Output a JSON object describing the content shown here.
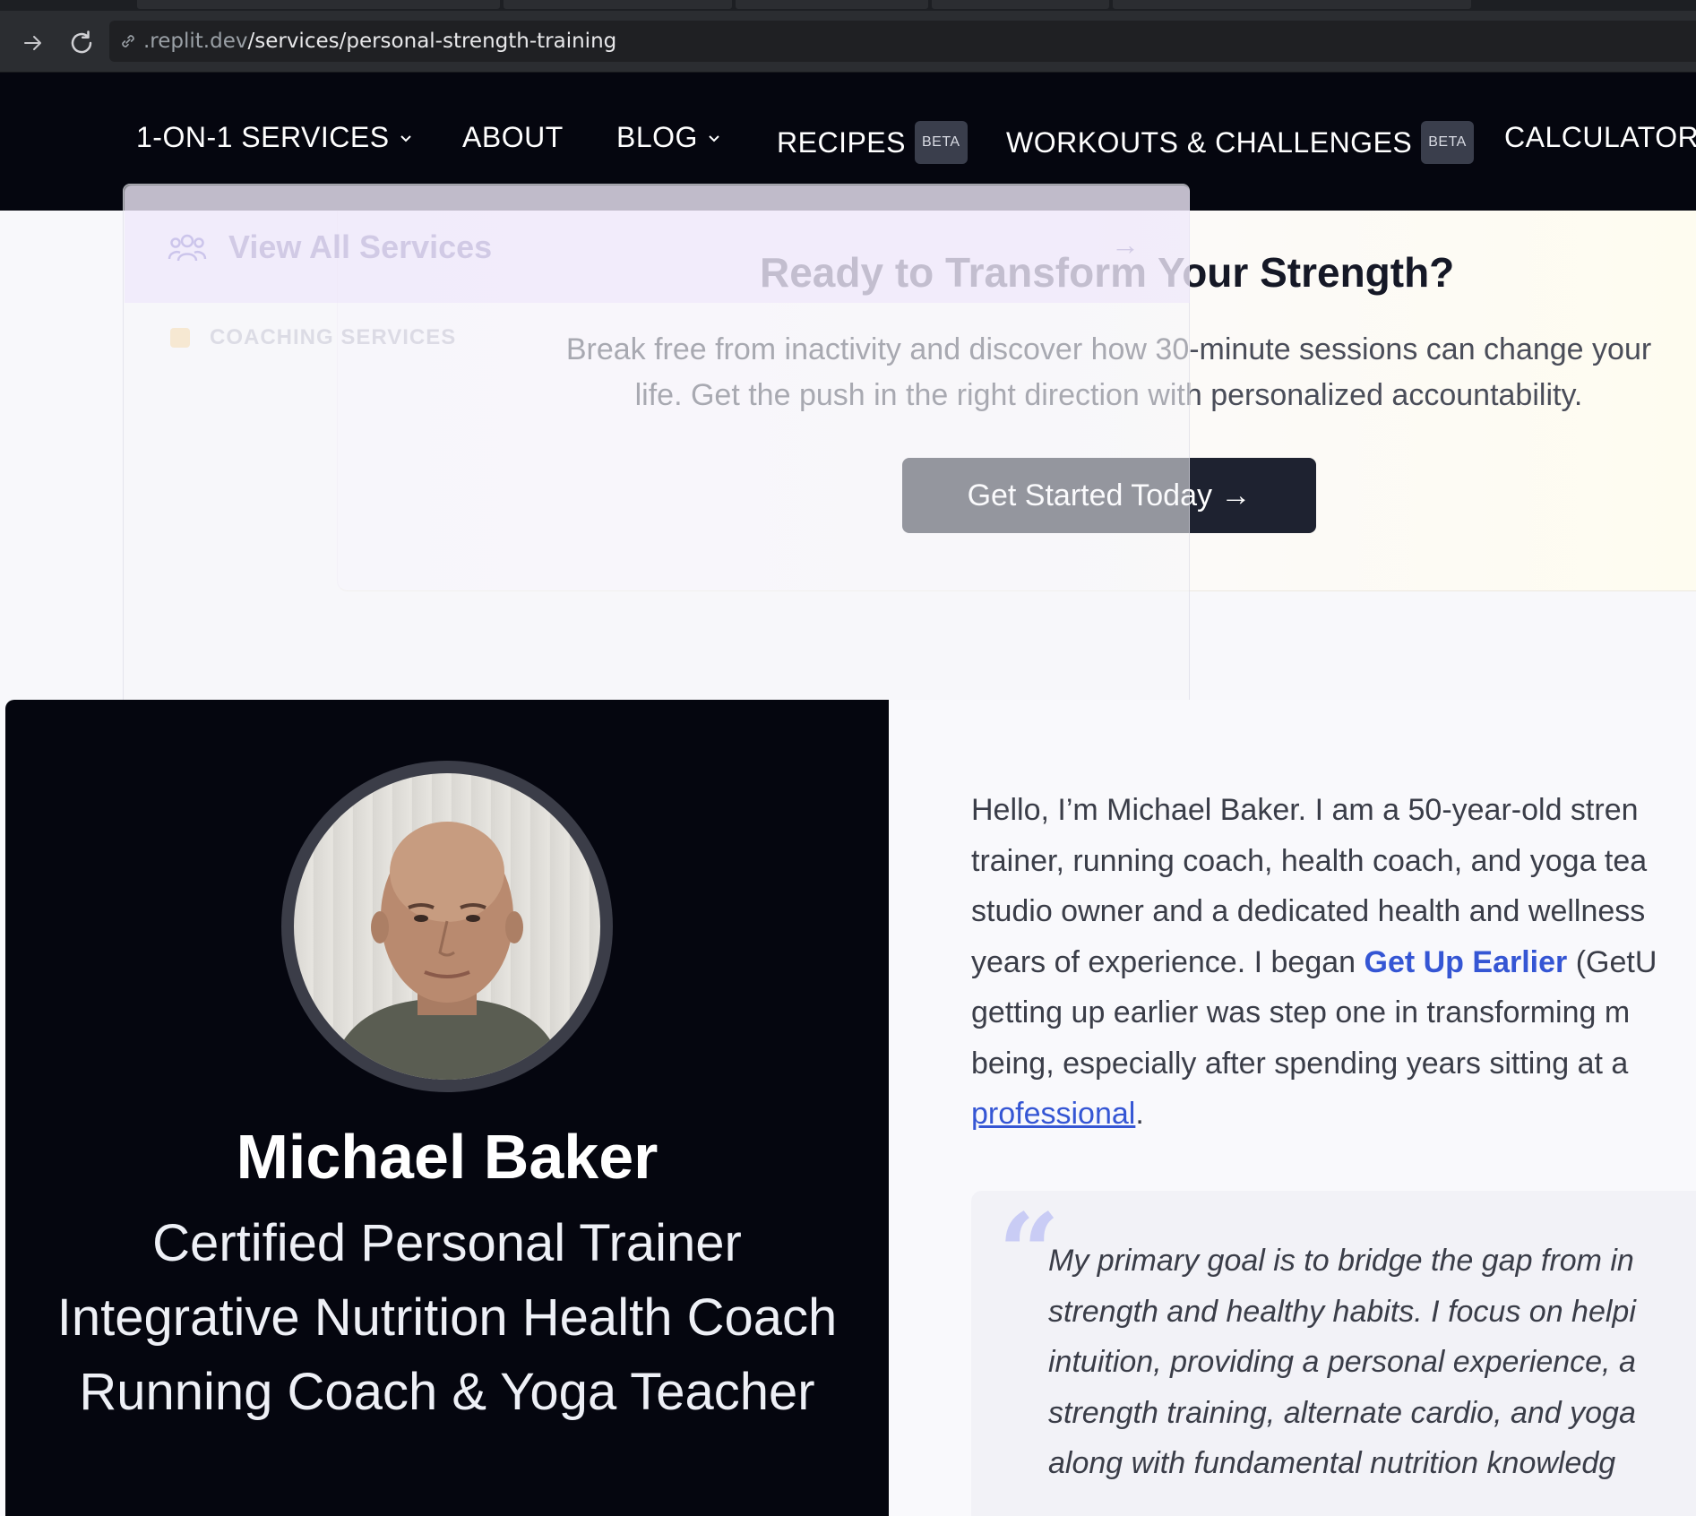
{
  "browser": {
    "url_prefix": ".replit.dev",
    "url_path": "/services/personal-strength-training"
  },
  "nav": {
    "items": [
      {
        "label": "1-ON-1 SERVICES"
      },
      {
        "label": "ABOUT"
      },
      {
        "label": "BLOG"
      },
      {
        "label": "RECIPES",
        "badge": "BETA"
      },
      {
        "label": "WORKOUTS & CHALLENGES",
        "badge": "BETA"
      },
      {
        "label": "CALCULATORS"
      }
    ]
  },
  "dropdown": {
    "view_all": "View All Services",
    "arrow": "→",
    "heading": "COACHING SERVICES"
  },
  "cta": {
    "title": "Ready to Transform Your Strength?",
    "description": "Break free from inactivity and discover how 30-minute sessions can change your life. Get the push in the right direction with personalized accountability.",
    "button": "Get Started Today →"
  },
  "bio": {
    "name": "Michael Baker",
    "credentials": [
      "Certified Personal Trainer",
      "Integrative Nutrition Health Coach",
      "Running Coach & Yoga Teacher"
    ],
    "para_lines": [
      "Hello, I’m Michael Baker. I am a 50-year-old stren",
      "trainer, running coach, health coach, and yoga tea",
      "studio owner and a dedicated health and wellness",
      "years of experience. I began ",
      "getting up earlier was step one in transforming m",
      "being, especially after spending years sitting at a",
      "professional"
    ],
    "link_get_up_earlier": "Get Up Earlier",
    "line4_tail": " (GetU",
    "line7_tail": ".",
    "quote_mark": "“",
    "quote_lines": [
      "My primary goal is to bridge the gap from in",
      "strength and healthy habits. I focus on helpi",
      "intuition, providing a personal experience, a",
      "strength training, alternate cardio, and yoga",
      "along with fundamental nutrition knowledg"
    ]
  }
}
